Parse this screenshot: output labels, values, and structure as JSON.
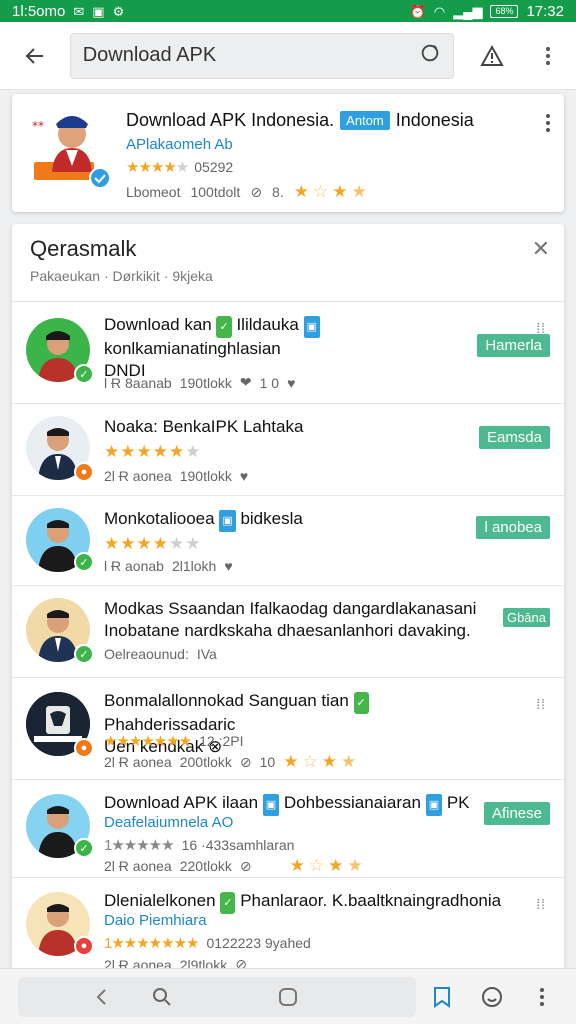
{
  "status_bar": {
    "left_text": "1l:5omo",
    "time": "17:32",
    "battery": "68%"
  },
  "search": {
    "query": "Download APK",
    "back_icon": "back-arrow-icon",
    "search_icon": "search-icon",
    "alert_icon": "alert-icon",
    "menu_icon": "kebab-menu-icon"
  },
  "featured": {
    "title": "Download APK Indonesia.",
    "chip": "Antom",
    "title_suffix": "Indonesia",
    "subtitle": "APlakaomeh Ab",
    "rating_text": "05292",
    "meta_left": "Lbomeot",
    "meta_mid": "100tdolt",
    "meta_right": "8.",
    "rating_value": 3.5
  },
  "panel": {
    "title": "Qerasmalk",
    "crumbs": "Pakaeukan · Dørkikit · 9kjeka",
    "close_icon": "close-icon"
  },
  "rows": [
    {
      "title_a": "Download kan",
      "title_b": "Ilildauka",
      "title_c": "konlkamianatinghlasian",
      "title_d": "DNDI",
      "meta": "Ɩ Ɍ 8aanab",
      "count": "190tlokk",
      "extra": "1 0",
      "pill": "Hamerla",
      "rating_value": 0
    },
    {
      "title_a": "Noaka: BenkaIPK Lahtaka",
      "meta": "2Ɩ Ɍ aonea",
      "count": "190tlokk",
      "pill": "Eamsda",
      "rating_value": 4.5
    },
    {
      "title_a": "Monkotaliooea",
      "title_b": "bidkesla",
      "meta": "Ɩ Ɍ aonab",
      "count": "2Ɩ1Ɩokh",
      "pill": "Ɩ anobea",
      "rating_value": 4
    },
    {
      "title_a": "Modkas Ssaandan Ifalkaodag dangardlakanasani",
      "title_b": "Inobatane nardkskaha dhaesanlanhori davaking.",
      "meta": "Oelreaounud:",
      "count": "IVa",
      "pill": "Gbāna",
      "rating_value": 0
    },
    {
      "title_a": "Bonmalallonnokad Sanguan tian",
      "title_b": "Phahderissadaric",
      "title_c": "Uen kendkak",
      "rating_text": "12 :2PI",
      "meta": "2Ɩ Ɍ aonea",
      "count": "200tlokk",
      "extra": "10",
      "rating_value": 4.5
    },
    {
      "title_a": "Download APK ilaan",
      "title_b": "Dohbessianaiaran",
      "title_c": "PK",
      "subtitle": "Deafelaiumnela AO",
      "rating_text": "16 ·433samhlaran",
      "meta": "2Ɩ Ɍ aonea",
      "count": "220tlokk",
      "pill": "Afinese",
      "rating_value": 5
    },
    {
      "title_a": "Dlenialelkonen",
      "title_b": "Phanlaraor. K.baaltknaingradhonia",
      "subtitle": "Daio Piemhiara",
      "rating_text": "0122223 9yahed",
      "meta": "2Ɩ Ɍ aonea",
      "count": "2Ɩ9tlokk",
      "rating_value": 5
    }
  ],
  "colors": {
    "status_green": "#149c4a",
    "accent_blue": "#1e88c9",
    "pill_green": "#4cb990",
    "star": "#f4a623"
  }
}
